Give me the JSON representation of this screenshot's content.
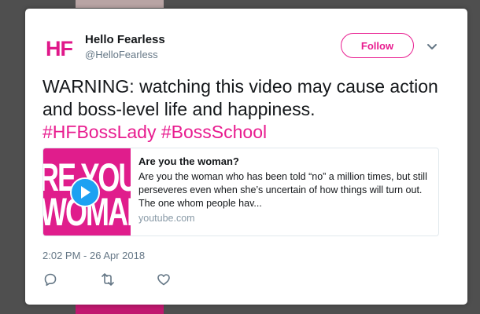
{
  "tweet": {
    "author_name": "Hello Fearless",
    "author_handle": "@HelloFearless",
    "avatar_text": "HF",
    "follow_label": "Follow",
    "text": "WARNING: watching this video may cause action and boss-level life and happiness.",
    "hashtags": [
      "#HFBossLady",
      "#BossSchool"
    ],
    "timestamp": "2:02 PM - 26 Apr 2018"
  },
  "preview": {
    "thumb_lines": [
      "RE YOU THE",
      "WOMAN"
    ],
    "title": "Are you the woman?",
    "description": "Are you the woman who has been told “no” a million times, but still perseveres even when she’s uncertain of how things will turn out. The one whom people hav...",
    "domain": "youtube.com"
  },
  "colors": {
    "accent": "#e81c8f",
    "link_blue": "#1da1f2",
    "muted": "#657786"
  },
  "icons": [
    "chevron-down-icon",
    "play-icon",
    "reply-icon",
    "retweet-icon",
    "like-icon"
  ]
}
